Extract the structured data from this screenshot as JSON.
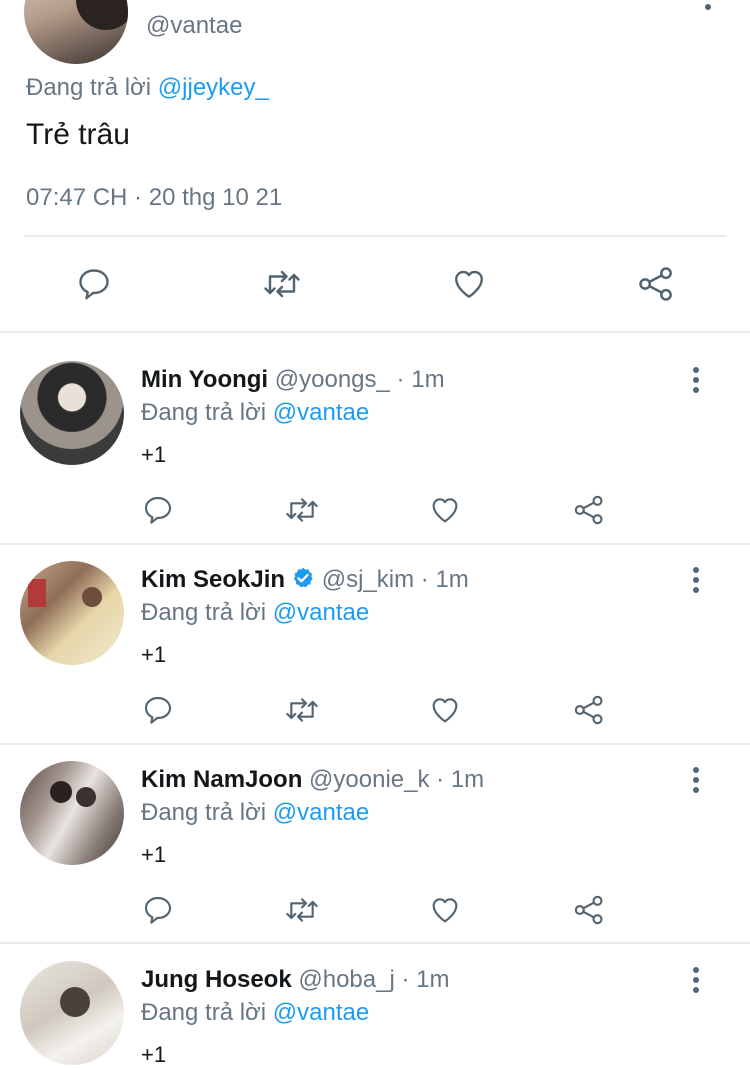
{
  "main_tweet": {
    "handle": "@vantae",
    "replying_prefix": "Đang trả lời",
    "replying_to": "@jjeykey_",
    "text": "Trẻ trâu",
    "timestamp": "07:47 CH · 20 thg 10 21"
  },
  "icons": {
    "reply": "reply-icon",
    "retweet": "retweet-icon",
    "like": "heart-icon",
    "share": "share-icon",
    "more": "more-vertical-icon",
    "verified": "verified-badge-icon"
  },
  "replies": [
    {
      "name": "Min Yoongi",
      "handle": "@yoongs_",
      "sep": "·",
      "time": "1m",
      "replying_prefix": "Đang trả lời",
      "replying_to": "@vantae",
      "text": "+1",
      "verified": false
    },
    {
      "name": "Kim SeokJin",
      "handle": "@sj_kim",
      "sep": "·",
      "time": "1m",
      "replying_prefix": "Đang trả lời",
      "replying_to": "@vantae",
      "text": "+1",
      "verified": true
    },
    {
      "name": "Kim NamJoon",
      "handle": "@yoonie_k",
      "sep": "·",
      "time": "1m",
      "replying_prefix": "Đang trả lời",
      "replying_to": "@vantae",
      "text": "+1",
      "verified": false
    },
    {
      "name": "Jung Hoseok",
      "handle": "@hoba_j",
      "sep": "·",
      "time": "1m",
      "replying_prefix": "Đang trả lời",
      "replying_to": "@vantae",
      "text": "+1",
      "verified": false
    }
  ],
  "colors": {
    "link": "#1d9bf0",
    "muted": "#687684",
    "divider": "#e6ecf0",
    "verified": "#1d9bf0"
  }
}
